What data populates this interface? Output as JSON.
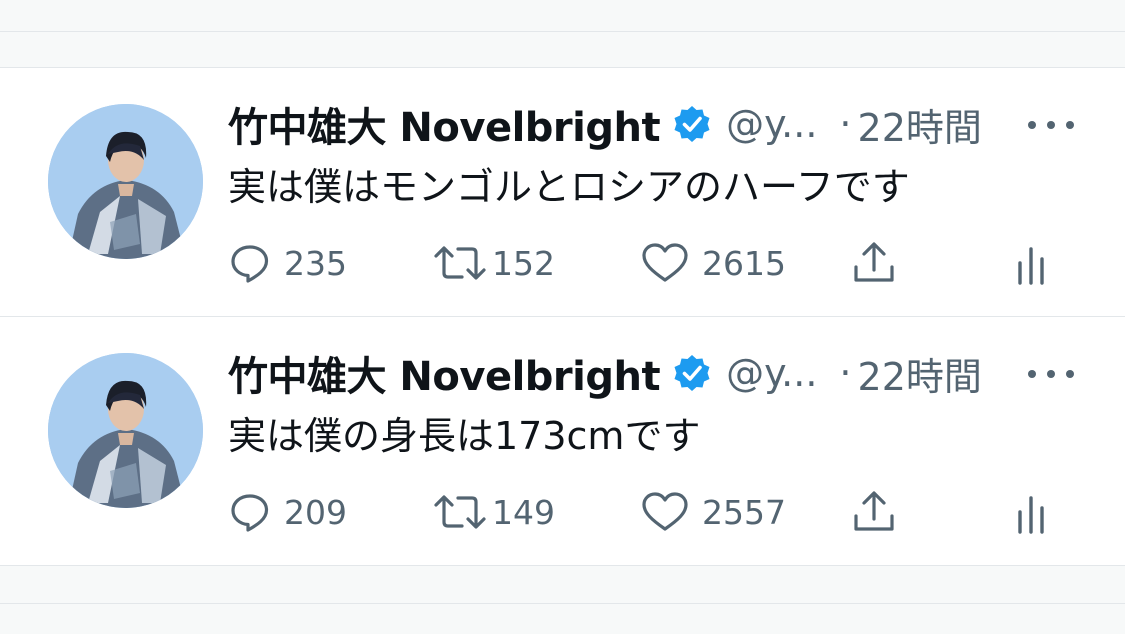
{
  "tweets": [
    {
      "author_name": "竹中雄大 Novelbright",
      "handle": "@y...",
      "separator": "·",
      "time": "22時間",
      "text": "実は僕はモンゴルとロシアのハーフです",
      "replies": "235",
      "retweets": "152",
      "likes": "2615"
    },
    {
      "author_name": "竹中雄大 Novelbright",
      "handle": "@y...",
      "separator": "·",
      "time": "22時間",
      "text": "実は僕の身長は173cmです",
      "replies": "209",
      "retweets": "149",
      "likes": "2557"
    }
  ],
  "icons": {
    "verified": "verified-badge-icon",
    "more": "more-dots-icon",
    "reply": "reply-bubble-icon",
    "retweet": "retweet-icon",
    "like": "heart-icon",
    "share": "share-upload-icon",
    "views": "views-bar-chart-icon"
  },
  "colors": {
    "text_primary": "#0f1419",
    "text_secondary": "#536471",
    "verified_blue": "#1d9bf0",
    "divider": "#e3e7ea",
    "background_band": "#f7f9f9"
  }
}
